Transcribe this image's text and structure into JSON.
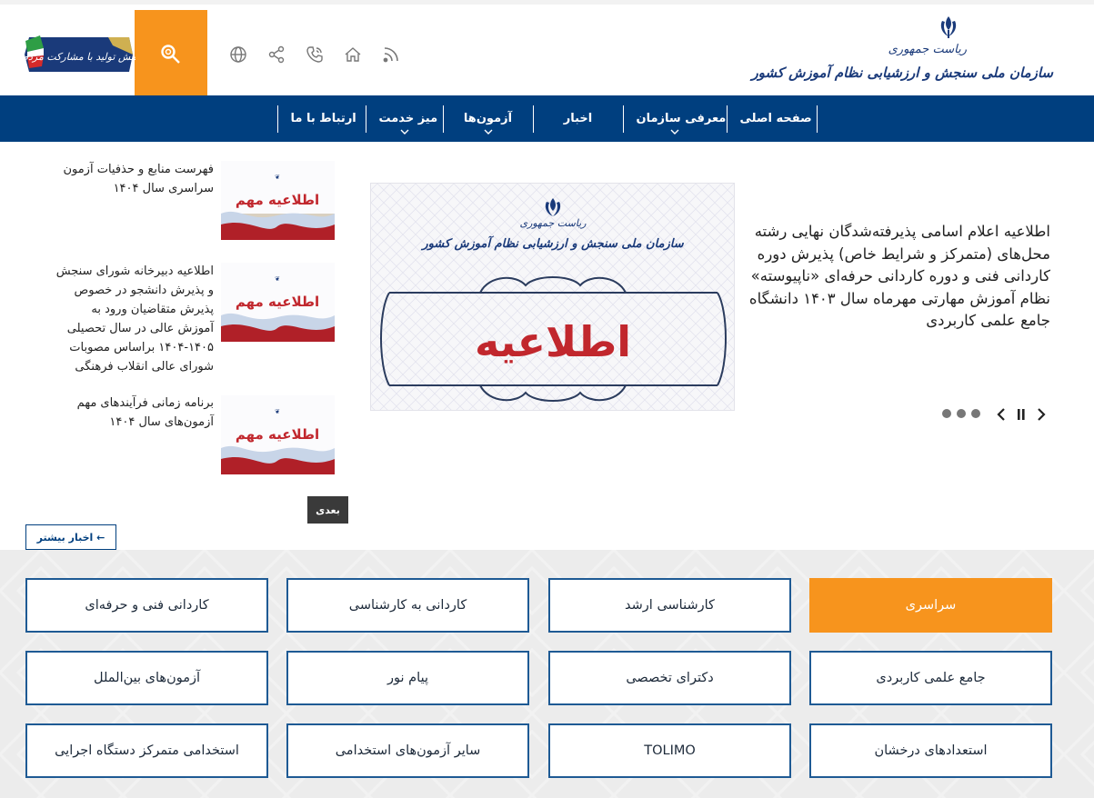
{
  "header": {
    "logo_line1": "ریاست جمهوری",
    "logo_line2": "سازمان ملی سنجش و ارزشیابی نظام آموزش کشور",
    "badge_text": "جهش تولید با مشارکت مردم",
    "icons": [
      "rss-icon",
      "home-icon",
      "phone-icon",
      "share-icon",
      "globe-icon",
      "search-icon"
    ]
  },
  "nav": {
    "items": [
      {
        "label": "صفحه اصلی",
        "dropdown": false
      },
      {
        "label": "معرفی سازمان",
        "dropdown": true
      },
      {
        "label": "اخبار",
        "dropdown": false
      },
      {
        "label": "آزمون‌ها",
        "dropdown": true
      },
      {
        "label": "میز خدمت",
        "dropdown": true
      },
      {
        "label": "ارتباط با ما",
        "dropdown": false
      }
    ]
  },
  "slider": {
    "headline": "اطلاعیه اعلام اسامی پذیرفته‌شدگان نهایی رشته محل‌های (متمرکز و شرایط خاص) پذیرش دوره کاردانی فنی و دوره کاردانی حرفه‌ای «ناپیوسته» نظام آموزش مهارتی مهرماه سال ۱۴۰۳ دانشگاه جامع علمی کاربردی",
    "image_top_text1": "ریاست جمهوری",
    "image_top_text2": "سازمان ملی سنجش و ارزشیابی نظام آموزش کشور",
    "image_title": "اطلاعیه",
    "slide_count": 3
  },
  "news": {
    "items": [
      {
        "text": "فهرست منابع و حذفیات آزمون سراسری سال ۱۴۰۴",
        "thumb_title": "اطلاعیه مهم"
      },
      {
        "text": "اطلاعیه دبیرخانه شورای سنجش و پذیرش دانشجو در خصوص پذیرش متقاضیان ورود به آموزش عالی در سال تحصیلی ۱۴۰۵-۱۴۰۴ براساس مصوبات شورای عالی انقلاب فرهنگی",
        "thumb_title": "اطلاعیه مهم"
      },
      {
        "text": "برنامه زمانی فرآیندهای مهم آزمون‌های سال ۱۴۰۴",
        "thumb_title": "اطلاعیه مهم"
      }
    ],
    "next_label": "بعدی",
    "more_label": "اخبار بیشتر ←"
  },
  "exams": {
    "tiles": [
      "سراسری",
      "کارشناسی ارشد",
      "کاردانی به کارشناسی",
      "کاردانی فنی و حرفه‌ای",
      "جامع علمی کاربردی",
      "دکترای تخصصی",
      "پیام نور",
      "آزمون‌های بین‌الملل",
      "استعدادهای درخشان",
      "TOLIMO",
      "سایر آزمون‌های استخدامی",
      "استخدامی متمرکز دستگاه اجرایی"
    ],
    "active_index": 0
  },
  "colors": {
    "brand_blue": "#003f7f",
    "accent_orange": "#f7941d"
  }
}
